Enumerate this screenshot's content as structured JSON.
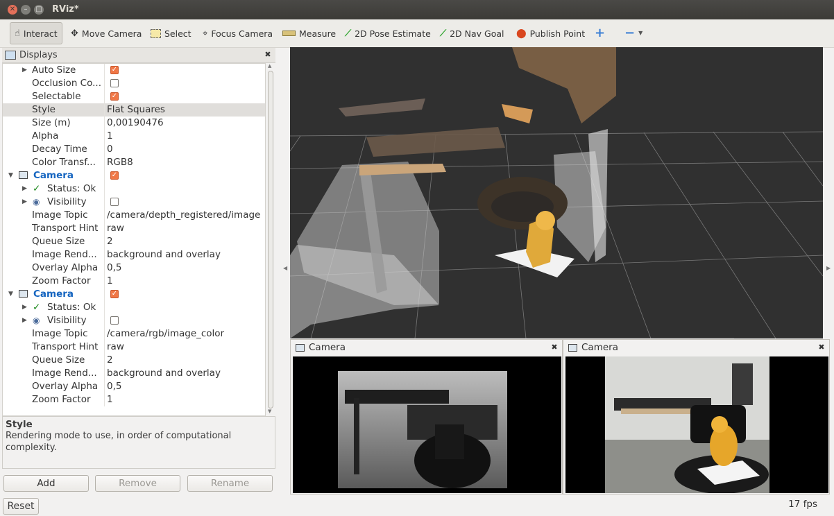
{
  "window": {
    "title": "RViz*"
  },
  "toolbar": {
    "tools": [
      {
        "label": "Interact",
        "icon": "interact-icon"
      },
      {
        "label": "Move Camera",
        "icon": "move-camera-icon"
      },
      {
        "label": "Select",
        "icon": "select-icon"
      },
      {
        "label": "Focus Camera",
        "icon": "focus-camera-icon"
      },
      {
        "label": "Measure",
        "icon": "ruler-icon"
      },
      {
        "label": "2D Pose Estimate",
        "icon": "pose-arrow-icon"
      },
      {
        "label": "2D Nav Goal",
        "icon": "nav-goal-arrow-icon"
      },
      {
        "label": "Publish Point",
        "icon": "map-pin-icon"
      }
    ],
    "colors": {
      "pose_arrow": "#2fa52f",
      "pin": "#d9471f",
      "plus": "#3b7fd4"
    }
  },
  "displays": {
    "title": "Displays",
    "rows": [
      {
        "name": "Auto Size",
        "value": "",
        "checkbox": true,
        "checked": true,
        "arrow": true
      },
      {
        "name": "Occlusion Co...",
        "value": "",
        "checkbox": true,
        "checked": false
      },
      {
        "name": "Selectable",
        "value": "",
        "checkbox": true,
        "checked": true
      },
      {
        "name": "Style",
        "value": "Flat Squares",
        "highlight": true
      },
      {
        "name": "Size (m)",
        "value": "0,00190476"
      },
      {
        "name": "Alpha",
        "value": "1"
      },
      {
        "name": "Decay Time",
        "value": "0"
      },
      {
        "name": "Color Transf...",
        "value": "RGB8"
      },
      {
        "name": "Camera",
        "value": "",
        "checkbox": true,
        "checked": true,
        "display": true
      },
      {
        "name": "Status: Ok",
        "value": "",
        "status": true
      },
      {
        "name": "Visibility",
        "value": "",
        "checkbox": true,
        "checked": false,
        "visibility": true
      },
      {
        "name": "Image Topic",
        "value": "/camera/depth_registered/image"
      },
      {
        "name": "Transport Hint",
        "value": "raw"
      },
      {
        "name": "Queue Size",
        "value": "2"
      },
      {
        "name": "Image Rend...",
        "value": "background and overlay"
      },
      {
        "name": "Overlay Alpha",
        "value": "0,5"
      },
      {
        "name": "Zoom Factor",
        "value": "1"
      },
      {
        "name": "Camera",
        "value": "",
        "checkbox": true,
        "checked": true,
        "display": true
      },
      {
        "name": "Status: Ok",
        "value": "",
        "status": true
      },
      {
        "name": "Visibility",
        "value": "",
        "checkbox": true,
        "checked": false,
        "visibility": true
      },
      {
        "name": "Image Topic",
        "value": "/camera/rgb/image_color"
      },
      {
        "name": "Transport Hint",
        "value": "raw"
      },
      {
        "name": "Queue Size",
        "value": "2"
      },
      {
        "name": "Image Rend...",
        "value": "background and overlay"
      },
      {
        "name": "Overlay Alpha",
        "value": "0,5"
      },
      {
        "name": "Zoom Factor",
        "value": "1"
      }
    ],
    "description": {
      "title": "Style",
      "body": "Rendering mode to use, in order of computational complexity."
    },
    "buttons": {
      "add": "Add",
      "remove": "Remove",
      "rename": "Rename"
    }
  },
  "camera_panels": [
    {
      "title": "Camera"
    },
    {
      "title": "Camera"
    }
  ],
  "status": {
    "reset": "Reset",
    "fps": "17 fps"
  },
  "colors": {
    "checkbox": "#f07746",
    "display_name": "#1565c0",
    "viewport": "#303030"
  }
}
